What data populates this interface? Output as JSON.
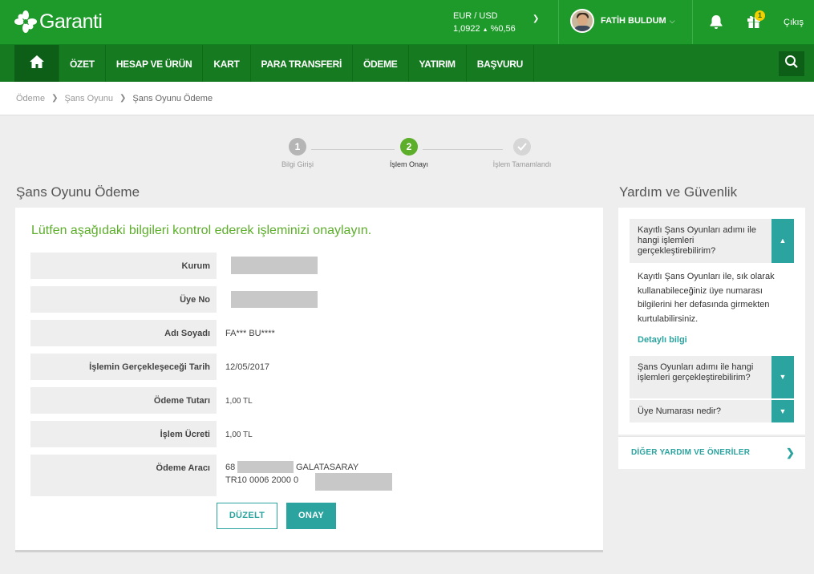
{
  "brand": {
    "name": "Garanti"
  },
  "currency": {
    "pair": "EUR / USD",
    "rate": "1,0922",
    "change": "%0,56",
    "trend_symbol": "▲"
  },
  "user": {
    "name": "FATİH BULDUM"
  },
  "notifications": {
    "gift_count": "1"
  },
  "logout_label": "Çıkış",
  "nav": {
    "items": [
      {
        "label": "ÖZET"
      },
      {
        "label": "HESAP VE ÜRÜN"
      },
      {
        "label": "KART"
      },
      {
        "label": "PARA TRANSFERİ"
      },
      {
        "label": "ÖDEME"
      },
      {
        "label": "YATIRIM"
      },
      {
        "label": "BAŞVURU"
      }
    ]
  },
  "breadcrumb": {
    "items": [
      "Ödeme",
      "Şans Oyunu",
      "Şans Oyunu Ödeme"
    ]
  },
  "stepper": {
    "steps": [
      {
        "number": "1",
        "label": "Bilgi Girişi",
        "state": "done"
      },
      {
        "number": "2",
        "label": "İşlem Onayı",
        "state": "active"
      },
      {
        "number": "",
        "label": "İşlem Tamamlandı",
        "state": "pending"
      }
    ]
  },
  "page": {
    "title": "Şans Oyunu Ödeme",
    "heading": "Lütfen aşağıdaki bilgileri kontrol ederek işleminizi onaylayın.",
    "rows": [
      {
        "label": "Kurum",
        "value": ""
      },
      {
        "label": "Üye No",
        "value": ""
      },
      {
        "label": "Adı Soyadı",
        "value": "FA*** BU****"
      },
      {
        "label": "İşlemin Gerçekleşeceği Tarih",
        "value": "12/05/2017"
      },
      {
        "label": "Ödeme Tutarı",
        "value": "1,00 TL"
      },
      {
        "label": "İşlem Ücreti",
        "value": "1,00 TL"
      },
      {
        "label": "Ödeme Aracı",
        "value_line1_prefix": "68",
        "value_line1_suffix": "GALATASARAY",
        "value_line2_prefix": "TR10 0006 2000 0"
      }
    ],
    "buttons": {
      "edit": "DÜZELT",
      "confirm": "ONAY"
    }
  },
  "help": {
    "title": "Yardım ve Güvenlik",
    "items": [
      {
        "question": "Kayıtlı Şans Oyunları adımı ile hangi işlemleri gerçekleştirebilirim?",
        "expanded": true
      },
      {
        "question": "Şans Oyunları adımı ile hangi işlemleri gerçekleştirebilirim?",
        "expanded": false
      },
      {
        "question": "Üye Numarası nedir?",
        "expanded": false
      }
    ],
    "answer": "Kayıtlı Şans Oyunları ile, sık olarak kullanabileceğiniz üye numarası bilgilerini her defasında girmekten kurtulabilirsiniz.",
    "detail_link": "Detaylı bilgi",
    "more_link": "DİĞER YARDIM VE ÖNERİLER"
  },
  "colors": {
    "brand_green": "#1e9a2b",
    "nav_green": "#167a21",
    "accent_teal": "#2ba39e",
    "heading_green": "#5cae2b"
  }
}
